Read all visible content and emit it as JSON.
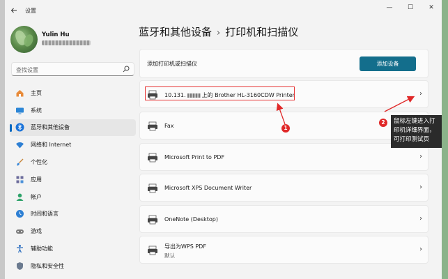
{
  "window": {
    "title": "设置",
    "controls": [
      "—",
      "☐",
      "✕"
    ]
  },
  "user": {
    "name": "Yulin Hu"
  },
  "search": {
    "placeholder": "查找设置"
  },
  "sidebar": {
    "items": [
      {
        "label": "主页",
        "icon": "home-icon"
      },
      {
        "label": "系统",
        "icon": "system-icon"
      },
      {
        "label": "蓝牙和其他设备",
        "icon": "bluetooth-icon",
        "active": true
      },
      {
        "label": "网络和 Internet",
        "icon": "wifi-icon"
      },
      {
        "label": "个性化",
        "icon": "brush-icon"
      },
      {
        "label": "应用",
        "icon": "apps-icon"
      },
      {
        "label": "帐户",
        "icon": "account-icon"
      },
      {
        "label": "时间和语言",
        "icon": "globe-clock-icon"
      },
      {
        "label": "游戏",
        "icon": "gamepad-icon"
      },
      {
        "label": "辅助功能",
        "icon": "accessibility-icon"
      },
      {
        "label": "隐私和安全性",
        "icon": "shield-icon"
      }
    ]
  },
  "breadcrumb": {
    "parent": "蓝牙和其他设备",
    "separator": "›",
    "current": "打印机和扫描仪"
  },
  "add_device": {
    "label": "添加打印机或扫描仪",
    "button": "添加设备"
  },
  "devices": [
    {
      "name_prefix": "10.131.",
      "name_suffix": "上的 Brother HL-3160CDW Printer",
      "icon": "printer-icon"
    },
    {
      "name": "Fax",
      "icon": "fax-icon"
    },
    {
      "name": "Microsoft Print to PDF",
      "icon": "printer-icon"
    },
    {
      "name": "Microsoft XPS Document Writer",
      "icon": "printer-icon"
    },
    {
      "name": "OneNote (Desktop)",
      "icon": "printer-icon"
    },
    {
      "name": "导出为WPS PDF",
      "sub": "默认",
      "icon": "printer-icon"
    }
  ],
  "annotations": {
    "badge1": "1",
    "badge2": "2",
    "tooltip_lines": [
      "鼠标左键进入打",
      "印机详细界面，",
      "可打印测试页"
    ]
  },
  "colors": {
    "accent": "#136e8c",
    "active_indicator": "#0067c0",
    "annotation_red": "#e02828"
  }
}
